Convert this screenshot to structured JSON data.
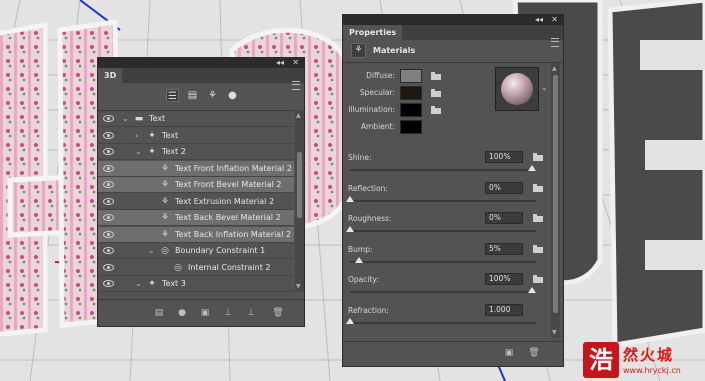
{
  "panel3d": {
    "title": "3D",
    "collapse": "◂◂",
    "close": "✕",
    "layers": [
      {
        "label": "Text",
        "level": 0,
        "arrow": "v",
        "icon": "folder-icon",
        "selected": false
      },
      {
        "label": "Text",
        "level": 1,
        "arrow": ">",
        "icon": "mesh-icon",
        "selected": false
      },
      {
        "label": "Text 2",
        "level": 1,
        "arrow": "v",
        "icon": "mesh-icon",
        "selected": false
      },
      {
        "label": "Text Front Inflation Material 2",
        "level": 2,
        "arrow": "",
        "icon": "material-icon",
        "selected": true
      },
      {
        "label": "Text Front Bevel Material 2",
        "level": 2,
        "arrow": "",
        "icon": "material-icon",
        "selected": true
      },
      {
        "label": "Text Extrusion Material 2",
        "level": 2,
        "arrow": "",
        "icon": "material-icon",
        "selected": false
      },
      {
        "label": "Text Back Bevel Material 2",
        "level": 2,
        "arrow": "",
        "icon": "material-icon",
        "selected": true
      },
      {
        "label": "Text Back Inflation Material 2",
        "level": 2,
        "arrow": "",
        "icon": "material-icon",
        "selected": true
      },
      {
        "label": "Boundary Constraint 1",
        "level": 2,
        "arrow": "v",
        "icon": "constraint-icon",
        "selected": false
      },
      {
        "label": "Internal Constraint 2",
        "level": 3,
        "arrow": "",
        "icon": "constraint-icon",
        "selected": false
      },
      {
        "label": "Text 3",
        "level": 1,
        "arrow": "v",
        "icon": "mesh-icon",
        "selected": false
      }
    ]
  },
  "props": {
    "title": "Properties",
    "collapse": "◂◂",
    "close": "✕",
    "section": "Materials",
    "colors": [
      {
        "label": "Diffuse:",
        "color": "#808080"
      },
      {
        "label": "Specular:",
        "color": "#1e1812"
      },
      {
        "label": "Illumination:",
        "color": "#000000"
      },
      {
        "label": "Ambient:",
        "color": "#000000"
      }
    ],
    "params": [
      {
        "label": "Shine:",
        "value": "100%",
        "level": 1.0
      },
      {
        "label": "Reflection:",
        "value": "0%",
        "level": 0.0
      },
      {
        "label": "Roughness:",
        "value": "0%",
        "level": 0.0
      },
      {
        "label": "Bump:",
        "value": "5%",
        "level": 0.05
      },
      {
        "label": "Opacity:",
        "value": "100%",
        "level": 1.0
      },
      {
        "label": "Refraction:",
        "value": "1.000",
        "level": 0.0
      }
    ]
  },
  "watermark": {
    "logo_char": "浩",
    "title": "然火城",
    "url": "www.hryckj.cn"
  },
  "colors": {
    "panel": "#535353",
    "selected_row": "#6e6e6e",
    "watermark": "#e01515"
  }
}
